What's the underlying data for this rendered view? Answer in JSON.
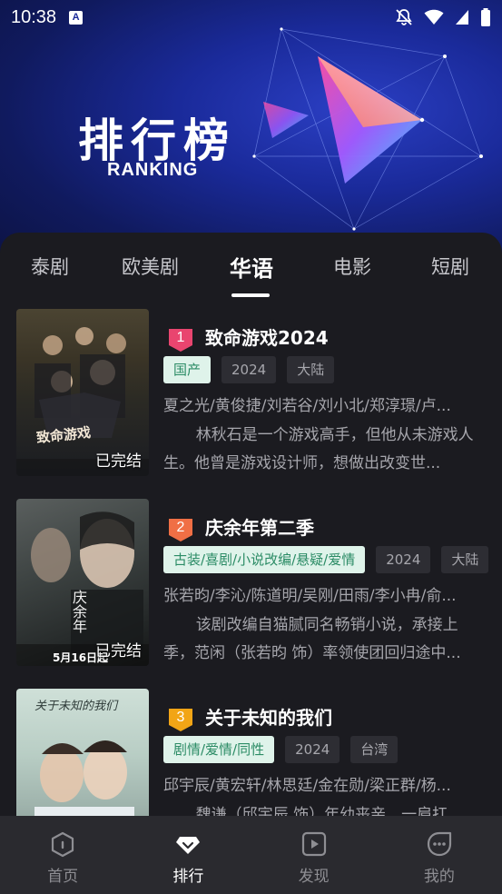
{
  "status": {
    "time": "10:38",
    "app_icon": "A"
  },
  "header": {
    "title": "排行榜",
    "subtitle": "RANKING"
  },
  "tabs": [
    {
      "label": "泰剧"
    },
    {
      "label": "欧美剧"
    },
    {
      "label": "华语",
      "active": true
    },
    {
      "label": "电影"
    },
    {
      "label": "短剧"
    }
  ],
  "items": [
    {
      "rank": "1",
      "title": "致命游戏2024",
      "genre": "国产",
      "year": "2024",
      "region": "大陆",
      "status": "已完结",
      "cast": "夏之光/黄俊捷/刘若谷/刘小北/郑淳璟/卢...",
      "desc": "林秋石是一个游戏高手，但他从未游戏人生。他曾是游戏设计师，想做出改变世...",
      "poster_text": "致命游戏"
    },
    {
      "rank": "2",
      "title": "庆余年第二季",
      "genre": "古装/喜剧/小说改编/悬疑/爱情",
      "year": "2024",
      "region": "大陆",
      "status": "已完结",
      "cast": "张若昀/李沁/陈道明/吴刚/田雨/李小冉/俞...",
      "desc": "该剧改编自猫腻同名畅销小说，承接上季，范闲（张若昀 饰）率领使团回归途中...",
      "poster_text": "庆余年",
      "poster_date": "5月16日起"
    },
    {
      "rank": "3",
      "title": "关于未知的我们",
      "genre": "剧情/爱情/同性",
      "year": "2024",
      "region": "台湾",
      "status": "",
      "cast": "邱宇辰/黄宏轩/林思廷/金在勋/梁正群/杨...",
      "desc": "魏谦（邱宇辰 饰）年幼丧亲，一肩扛...",
      "poster_text": "关于未知的我们"
    }
  ],
  "nav": [
    {
      "label": "首页",
      "icon": "home-icon"
    },
    {
      "label": "排行",
      "icon": "ranking-icon",
      "active": true
    },
    {
      "label": "发现",
      "icon": "discover-icon"
    },
    {
      "label": "我的",
      "icon": "profile-icon"
    }
  ],
  "colors": {
    "header_bg": "#1a2a9a",
    "panel_bg": "#1b1b20",
    "rank1": "#e9456f",
    "rank2": "#f06f45",
    "rank3": "#f2a516",
    "genre_tag_bg": "#dff3ea",
    "genre_tag_text": "#2c8c66"
  }
}
